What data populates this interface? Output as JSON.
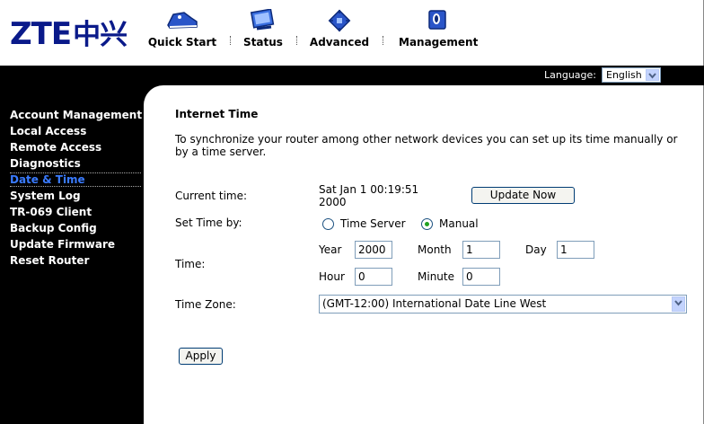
{
  "brand": {
    "logo_latin": "ZTE",
    "logo_cn": "中兴"
  },
  "nav": [
    {
      "label": "Quick Start",
      "icon": "sneaker-icon"
    },
    {
      "label": "Status",
      "icon": "monitor-icon"
    },
    {
      "label": "Advanced",
      "icon": "chip-icon"
    },
    {
      "label": "Management",
      "icon": "server-icon"
    }
  ],
  "language": {
    "label": "Language:",
    "value": "English"
  },
  "sidebar": {
    "items": [
      {
        "label": "Account Management"
      },
      {
        "label": "Local Access"
      },
      {
        "label": "Remote Access"
      },
      {
        "label": "Diagnostics"
      },
      {
        "label": "Date & Time",
        "active": true
      },
      {
        "label": "System Log"
      },
      {
        "label": "TR-069 Client"
      },
      {
        "label": "Backup Config"
      },
      {
        "label": "Update Firmware"
      },
      {
        "label": "Reset Router"
      }
    ]
  },
  "page": {
    "title": "Internet Time",
    "description": "To synchronize your router among other network devices you can set up its time manually or by a time server.",
    "current_time_label": "Current time:",
    "current_time_line1": "Sat Jan 1 00:19:51",
    "current_time_line2": "2000",
    "update_button": "Update Now",
    "set_time_by_label": "Set Time by:",
    "option_time_server": "Time Server",
    "option_manual": "Manual",
    "selected_option": "Manual",
    "time_label": "Time:",
    "year_label": "Year",
    "year_value": "2000",
    "month_label": "Month",
    "month_value": "1",
    "day_label": "Day",
    "day_value": "1",
    "hour_label": "Hour",
    "hour_value": "0",
    "minute_label": "Minute",
    "minute_value": "0",
    "time_zone_label": "Time Zone:",
    "time_zone_value": "(GMT-12:00) International Date Line West",
    "apply_button": "Apply"
  },
  "colors": {
    "brand_blue": "#0a1a8a",
    "active_link": "#3a7bff",
    "sidebar_bg": "#000000"
  }
}
